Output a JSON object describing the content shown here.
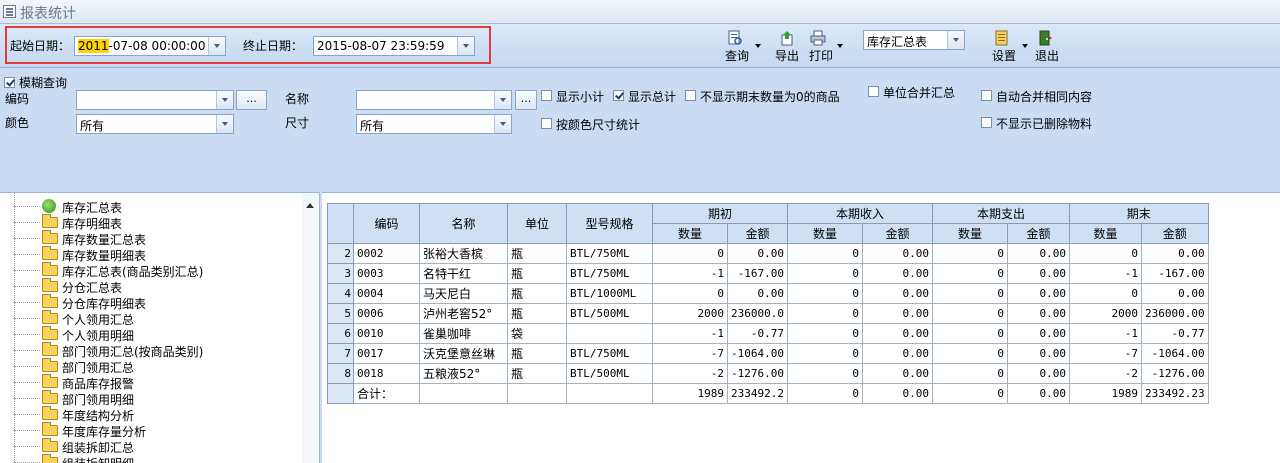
{
  "window": {
    "title": "报表统计"
  },
  "toolbar": {
    "start_date_label": "起始日期：",
    "start_date_highlight": "2011",
    "start_date_rest": "-07-08 00:00:00",
    "end_date_label": "终止日期：",
    "end_date_value": "2015-08-07 23:59:59",
    "query_label": "查询",
    "export_label": "导出",
    "print_label": "打印",
    "report_select_value": "库存汇总表",
    "settings_label": "设置",
    "exit_label": "退出"
  },
  "filters": {
    "fuzzy_query_label": "模糊查询",
    "fuzzy_query_checked": true,
    "code_label": "编码",
    "code_value": "",
    "name_label": "名称",
    "name_value": "",
    "color_label": "颜色",
    "color_value": "所有",
    "size_label": "尺寸",
    "size_value": "所有",
    "ellipsis": "...",
    "show_subtotal_label": "显示小计",
    "show_subtotal_checked": false,
    "show_total_label": "显示总计",
    "show_total_checked": true,
    "hide_zero_end_label": "不显示期末数量为0的商品",
    "hide_zero_end_checked": false,
    "merge_unit_label": "单位合并汇总",
    "merge_unit_checked": false,
    "auto_merge_label": "自动合并相同内容",
    "auto_merge_checked": false,
    "by_color_size_label": "按颜色尺寸统计",
    "by_color_size_checked": false,
    "hide_deleted_label": "不显示已删除物料",
    "hide_deleted_checked": false
  },
  "tree": {
    "items": [
      {
        "label": "库存汇总表",
        "icon": "leaf-icon"
      },
      {
        "label": "库存明细表",
        "icon": "folder-icon"
      },
      {
        "label": "库存数量汇总表",
        "icon": "folder-icon"
      },
      {
        "label": "库存数量明细表",
        "icon": "folder-icon"
      },
      {
        "label": "库存汇总表(商品类别汇总)",
        "icon": "folder-icon"
      },
      {
        "label": "分仓汇总表",
        "icon": "folder-icon"
      },
      {
        "label": "分仓库存明细表",
        "icon": "folder-icon"
      },
      {
        "label": "个人领用汇总",
        "icon": "folder-icon"
      },
      {
        "label": "个人领用明细",
        "icon": "folder-icon"
      },
      {
        "label": "部门领用汇总(按商品类别)",
        "icon": "folder-icon"
      },
      {
        "label": "部门领用汇总",
        "icon": "folder-icon"
      },
      {
        "label": "商品库存报警",
        "icon": "folder-icon"
      },
      {
        "label": "部门领用明细",
        "icon": "folder-icon"
      },
      {
        "label": "年度结构分析",
        "icon": "folder-icon"
      },
      {
        "label": "年度库存量分析",
        "icon": "folder-icon"
      },
      {
        "label": "组装拆卸汇总",
        "icon": "folder-icon"
      },
      {
        "label": "组装拆卸明细",
        "icon": "folder-icon"
      }
    ]
  },
  "grid": {
    "headers": {
      "code": "编码",
      "name": "名称",
      "unit": "单位",
      "spec": "型号规格",
      "opening": "期初",
      "income": "本期收入",
      "expense": "本期支出",
      "closing": "期末",
      "qty": "数量",
      "amount": "金额"
    },
    "rows": [
      {
        "rn": "2",
        "code": "0002",
        "name": "张裕大香槟",
        "unit": "瓶",
        "spec": "BTL/750ML",
        "q1": "0",
        "a1": "0.00",
        "q2": "0",
        "a2": "0.00",
        "q3": "0",
        "a3": "0.00",
        "q4": "0",
        "a4": "0.00"
      },
      {
        "rn": "3",
        "code": "0003",
        "name": "名特干红",
        "unit": "瓶",
        "spec": "BTL/750ML",
        "q1": "-1",
        "a1": "-167.00",
        "q2": "0",
        "a2": "0.00",
        "q3": "0",
        "a3": "0.00",
        "q4": "-1",
        "a4": "-167.00"
      },
      {
        "rn": "4",
        "code": "0004",
        "name": "马天尼白",
        "unit": "瓶",
        "spec": "BTL/1000ML",
        "q1": "0",
        "a1": "0.00",
        "q2": "0",
        "a2": "0.00",
        "q3": "0",
        "a3": "0.00",
        "q4": "0",
        "a4": "0.00"
      },
      {
        "rn": "5",
        "code": "0006",
        "name": "泸州老窖52°",
        "unit": "瓶",
        "spec": "BTL/500ML",
        "q1": "2000",
        "a1": "236000.0",
        "q2": "0",
        "a2": "0.00",
        "q3": "0",
        "a3": "0.00",
        "q4": "2000",
        "a4": "236000.00"
      },
      {
        "rn": "6",
        "code": "0010",
        "name": "雀巢咖啡",
        "unit": "袋",
        "spec": "",
        "q1": "-1",
        "a1": "-0.77",
        "q2": "0",
        "a2": "0.00",
        "q3": "0",
        "a3": "0.00",
        "q4": "-1",
        "a4": "-0.77"
      },
      {
        "rn": "7",
        "code": "0017",
        "name": "沃克堡意丝琳",
        "unit": "瓶",
        "spec": "BTL/750ML",
        "q1": "-7",
        "a1": "-1064.00",
        "q2": "0",
        "a2": "0.00",
        "q3": "0",
        "a3": "0.00",
        "q4": "-7",
        "a4": "-1064.00"
      },
      {
        "rn": "8",
        "code": "0018",
        "name": "五粮液52°",
        "unit": "瓶",
        "spec": "BTL/500ML",
        "q1": "-2",
        "a1": "-1276.00",
        "q2": "0",
        "a2": "0.00",
        "q3": "0",
        "a3": "0.00",
        "q4": "-2",
        "a4": "-1276.00"
      }
    ],
    "total": {
      "label": "合计：",
      "q1": "1989",
      "a1": "233492.2",
      "q2": "0",
      "a2": "0.00",
      "q3": "0",
      "a3": "0.00",
      "q4": "1989",
      "a4": "233492.23"
    }
  },
  "colors": {
    "accent": "#e33a3a",
    "highlight": "#ffd400",
    "header_bg": "#cfe0f5",
    "panel_bg": "#c9dcf3"
  }
}
